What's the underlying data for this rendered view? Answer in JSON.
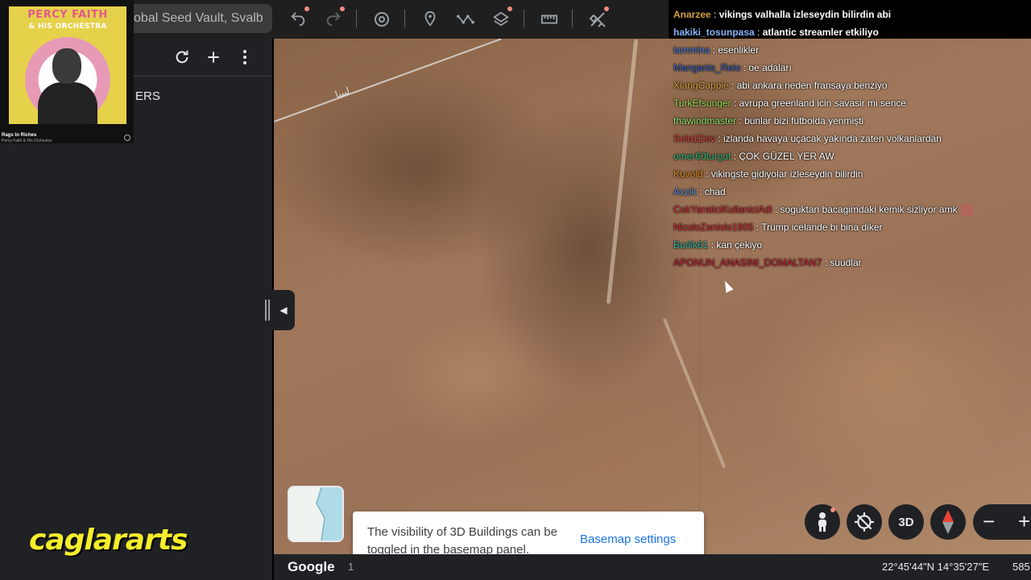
{
  "toolbar": {
    "search_value": "obal Seed Vault, Svalb",
    "buttons": [
      {
        "name": "undo-icon",
        "dot": true
      },
      {
        "name": "redo-icon",
        "dot": true
      },
      {
        "name": "history-icon",
        "dot": false
      },
      {
        "name": "placemark-icon",
        "dot": false
      },
      {
        "name": "path-icon",
        "dot": false
      },
      {
        "name": "layers-icon",
        "dot": true
      },
      {
        "name": "ruler-icon",
        "dot": false
      },
      {
        "name": "satellite-icon",
        "dot": true
      }
    ]
  },
  "album": {
    "artist": "PERCY FAITH",
    "subtitle": "& HIS ORCHESTRA",
    "title": "Rags to Riches",
    "sub2": "Percy Faith & His Orchestra"
  },
  "left_panel": {
    "title_partial": "ERS"
  },
  "map": {
    "label": "ليبيا"
  },
  "chat": [
    {
      "user": "Anarzee",
      "color": "#d5a03f",
      "msg": "vikings valhalla izleseydin bilirdin abi",
      "bold": true
    },
    {
      "user": "hakiki_tosunpasa",
      "color": "#8ab4f8",
      "msg": "atlantic streamler etkiliyo",
      "bold": true
    },
    {
      "user": "iammina",
      "color": "#4a7bd8",
      "msg": "esenlikler",
      "bold": false
    },
    {
      "user": "Manganis_Reio",
      "color": "#3a63c0",
      "msg": "oe adaları",
      "bold": false
    },
    {
      "user": "XiangCappie",
      "color": "#d9a441",
      "msg": "abi ankara neden fransaya benziyo",
      "bold": false
    },
    {
      "user": "TurkEfsunger",
      "color": "#9be054",
      "msg": "avrupa greenland icin savasir mi sence",
      "bold": false
    },
    {
      "user": "thawindmaster",
      "color": "#8fe36a",
      "msg": "bunlar bizi futbolda yenmişti",
      "bold": false
    },
    {
      "user": "Solo1Dev",
      "color": "#e04040",
      "msg": "izlanda havaya uçacak yakında zaten volkanlardan",
      "bold": false
    },
    {
      "user": "omer60turgut",
      "color": "#30b87a",
      "msg": "ÇOK GÜZEL YER AW",
      "bold": false
    },
    {
      "user": "Kuvold",
      "color": "#e08a20",
      "msg": "vikingste gidiyolar izleseydin bilirdin",
      "bold": false
    },
    {
      "user": "Axzik",
      "color": "#5b8fe0",
      "msg": "chad",
      "bold": false
    },
    {
      "user": "CokYaraticiKullaniciAdi",
      "color": "#d0303a",
      "msg": "soguktan bacagimdaki kemik sizliyor amk",
      "bold": false,
      "emote": true
    },
    {
      "user": "NicoloZaniolo1905",
      "color": "#d2303c",
      "msg": "Trump icelande bi bina diker",
      "bold": false
    },
    {
      "user": "Burlik61",
      "color": "#2fb3a0",
      "msg": "kan çekiyo",
      "bold": false
    },
    {
      "user": "APONUN_ANASINI_DOMALTAN7",
      "color": "#c8283a",
      "msg": "suudlar",
      "bold": false
    }
  ],
  "map_controls": {
    "btn_3d": "3D",
    "zoom_out": "−",
    "zoom_in": "+"
  },
  "toast": {
    "message": "The visibility of 3D Buildings can be toggled in the basemap panel.",
    "action": "Basemap settings"
  },
  "bottom_bar": {
    "logo": "Google",
    "scale_partial": "1",
    "coordinates": "22°45'44\"N 14°35'27\"E",
    "altitude_partial": "585"
  },
  "watermark": "caglararts"
}
